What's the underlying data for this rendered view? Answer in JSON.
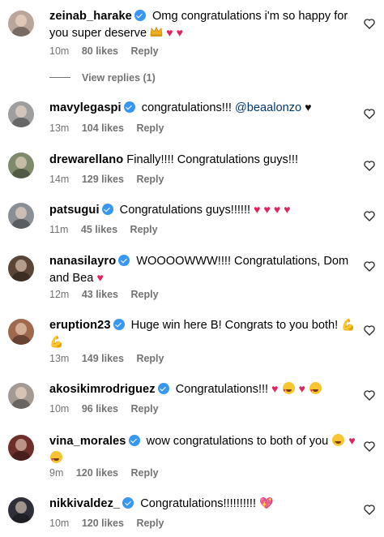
{
  "comments": [
    {
      "username": "zeinab_harake",
      "verified": true,
      "text": "Omg congratulations i'm so happy for you super deserve",
      "emoji": [
        "👑",
        "♥",
        "♥"
      ],
      "time": "10m",
      "likes": "80 likes",
      "reply": "Reply",
      "avatar_color": "#b9a59a"
    },
    {
      "username": "mavylegaspi",
      "verified": true,
      "text": "congratulations!!! @beaalonzo",
      "emoji": [
        "♥"
      ],
      "time": "13m",
      "likes": "104 likes",
      "reply": "Reply",
      "avatar_color": "#9e9e9e"
    },
    {
      "username": "drewarellano",
      "verified": false,
      "text": "Finally!!!! Congratulations guys!!!",
      "emoji": [],
      "time": "14m",
      "likes": "129 likes",
      "reply": "Reply",
      "avatar_color": "#7f8a6a"
    },
    {
      "username": "patsugui",
      "verified": true,
      "text": "Congratulations guys!!!!!!",
      "emoji": [
        "♥",
        "♥",
        "♥",
        "♥"
      ],
      "time": "11m",
      "likes": "45 likes",
      "reply": "Reply",
      "avatar_color": "#8a8f95"
    },
    {
      "username": "nanasilayro",
      "verified": true,
      "text": "WOOOOWWW!!!! Congratulations, Dom and Bea",
      "emoji": [
        "♥"
      ],
      "time": "12m",
      "likes": "43 likes",
      "reply": "Reply",
      "avatar_color": "#5b4636"
    },
    {
      "username": "eruption23",
      "verified": true,
      "text": "Huge win here B! Congrats to you both!",
      "emoji": [
        "💪",
        "💪"
      ],
      "time": "13m",
      "likes": "149 likes",
      "reply": "Reply",
      "avatar_color": "#a0684c"
    },
    {
      "username": "akosikimrodriguez",
      "verified": true,
      "text": "Congratulations!!!",
      "emoji": [
        "♥",
        "😍",
        "♥",
        "😍"
      ],
      "time": "10m",
      "likes": "96 likes",
      "reply": "Reply",
      "avatar_color": "#a49a94"
    },
    {
      "username": "vina_morales",
      "verified": true,
      "text": "wow congratulations to both of you",
      "emoji": [
        "😊",
        "♥",
        "😍"
      ],
      "time": "9m",
      "likes": "120 likes",
      "reply": "Reply",
      "avatar_color": "#6e2f2a"
    },
    {
      "username": "nikkivaldez_",
      "verified": true,
      "text": "Congratulations!!!!!!!!!!",
      "emoji": [
        "💖"
      ],
      "time": "10m",
      "likes": "120 likes",
      "reply": "Reply",
      "avatar_color": "#2f2f3a"
    }
  ],
  "view_replies": "View replies (1)",
  "colors": {
    "verified": "#3897f0",
    "meta": "#737373",
    "mention": "#00376b",
    "heart": "#e0245e"
  }
}
